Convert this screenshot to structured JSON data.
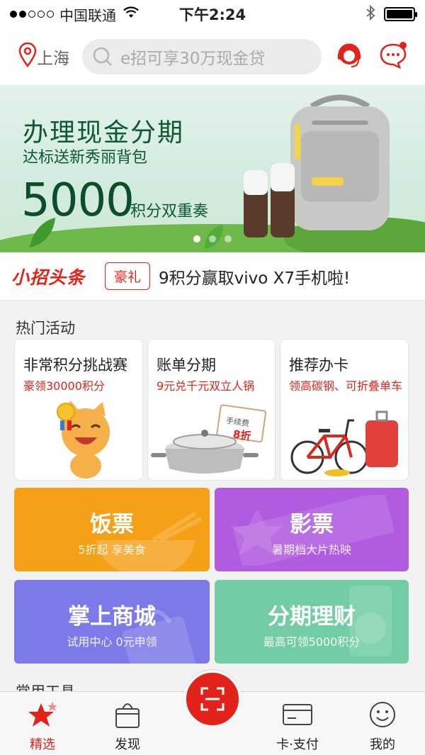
{
  "status_bar": {
    "carrier": "中国联通",
    "time": "下午2:24"
  },
  "header": {
    "location": "上海",
    "search_placeholder": "e招可享30万现金贷"
  },
  "banner": {
    "title": "办理现金分期",
    "subtitle": "达标送新秀丽背包",
    "number": "5000",
    "suffix": "积分双重奏",
    "page_count": 3,
    "active_page": 0
  },
  "headline": {
    "brand": "小招头条",
    "tag": "豪礼",
    "text": "9积分赢取vivo X7手机啦!"
  },
  "hot_section": {
    "title": "热门活动",
    "items": [
      {
        "title": "非常积分挑战赛",
        "subtitle": "豪领30000积分",
        "icon": "cat-mascot-icon"
      },
      {
        "title": "账单分期",
        "subtitle": "9元兑千元双立人锅",
        "icon": "pot-icon",
        "badge_line1": "手续费",
        "badge_line2": "8折"
      },
      {
        "title": "推荐办卡",
        "subtitle": "领高碳钢、可折叠单车",
        "icon": "bicycle-icon"
      }
    ]
  },
  "tiles": [
    {
      "title": "饭票",
      "subtitle": "5折起 享美食",
      "color": "#f6a018"
    },
    {
      "title": "影票",
      "subtitle": "暑期档大片热映",
      "color": "#b05be0"
    },
    {
      "title": "掌上商城",
      "subtitle": "试用中心 0元申领",
      "color": "#7c7ae8"
    },
    {
      "title": "分期理财",
      "subtitle": "最高可领5000积分",
      "color": "#72cda4"
    }
  ],
  "next_section_title": "常用工具",
  "tab_bar": {
    "items": [
      {
        "label": "精选",
        "active": true,
        "icon": "star-icon"
      },
      {
        "label": "发现",
        "active": false,
        "icon": "bag-icon"
      },
      {
        "label": "卡·支付",
        "active": false,
        "icon": "card-icon"
      },
      {
        "label": "我的",
        "active": false,
        "icon": "smile-icon"
      }
    ],
    "center_icon": "scan-icon"
  },
  "colors": {
    "brand_red": "#e2231a",
    "banner_green": "#0d5a32"
  }
}
